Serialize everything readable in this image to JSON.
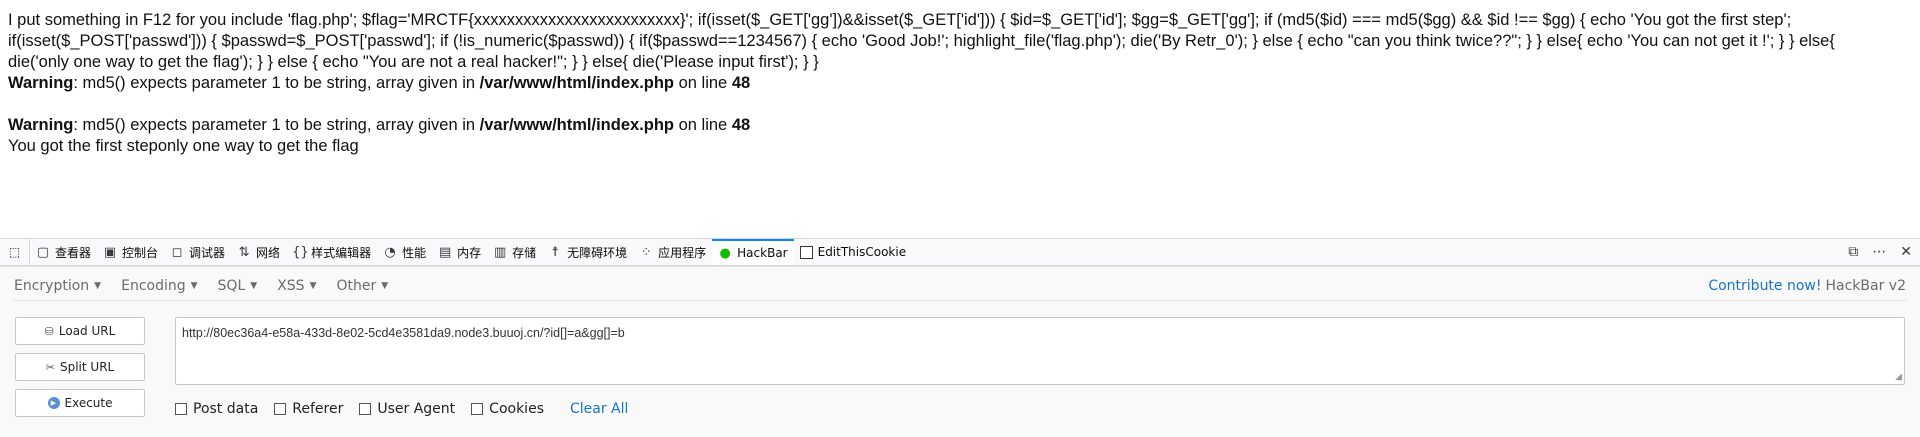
{
  "page": {
    "source_line1": "I put something in F12 for you include 'flag.php'; $flag='MRCTF{xxxxxxxxxxxxxxxxxxxxxxxxx}'; if(isset($_GET['gg'])&&isset($_GET['id'])) { $id=$_GET['id']; $gg=$_GET['gg']; if (md5($id) === md5($gg) && $id !== $gg) { echo 'You got the first step';",
    "source_line2": "if(isset($_POST['passwd'])) { $passwd=$_POST['passwd']; if (!is_numeric($passwd)) { if($passwd==1234567) { echo 'Good Job!'; highlight_file('flag.php'); die('By Retr_0'); } else { echo \"can you think twice??\"; } } else{ echo 'You can not get it !'; } } else{",
    "source_line3": "die('only one way to get the flag'); } } else { echo \"You are not a real hacker!\"; } } else{ die('Please input first'); } }",
    "warnings": [
      {
        "label": "Warning",
        "message": ": md5() expects parameter 1 to be string, array given in ",
        "file": "/var/www/html/index.php",
        "on_line": " on line ",
        "line": "48"
      },
      {
        "label": "Warning",
        "message": ": md5() expects parameter 1 to be string, array given in ",
        "file": "/var/www/html/index.php",
        "on_line": " on line ",
        "line": "48"
      }
    ],
    "output": "You got the first steponly one way to get the flag"
  },
  "devtools": {
    "tabs": [
      {
        "label": "查看器",
        "icon": "inspector-icon"
      },
      {
        "label": "控制台",
        "icon": "console-icon"
      },
      {
        "label": "调试器",
        "icon": "debugger-icon"
      },
      {
        "label": "网络",
        "icon": "network-icon"
      },
      {
        "label": "样式编辑器",
        "icon": "style-editor-icon"
      },
      {
        "label": "性能",
        "icon": "performance-icon"
      },
      {
        "label": "内存",
        "icon": "memory-icon"
      },
      {
        "label": "存储",
        "icon": "storage-icon"
      },
      {
        "label": "无障碍环境",
        "icon": "accessibility-icon"
      },
      {
        "label": "应用程序",
        "icon": "application-icon"
      },
      {
        "label": "HackBar",
        "icon": "hackbar-icon"
      },
      {
        "label": "EditThisCookie",
        "icon": "editthiscookie-icon"
      }
    ],
    "active_tab": "HackBar",
    "accent": "#0a84ff"
  },
  "hackbar": {
    "menu": [
      "Encryption",
      "Encoding",
      "SQL",
      "XSS",
      "Other"
    ],
    "contribute": "Contribute now!",
    "version": "HackBar v2",
    "buttons": {
      "load": "Load URL",
      "split": "Split URL",
      "execute": "Execute"
    },
    "url": "http://80ec36a4-e58a-433d-8e02-5cd4e3581da9.node3.buuoj.cn/?id[]=a&gg[]=b",
    "options": [
      "Post data",
      "Referer",
      "User Agent",
      "Cookies"
    ],
    "clear_all": "Clear All",
    "link_color": "#1a73c7"
  }
}
